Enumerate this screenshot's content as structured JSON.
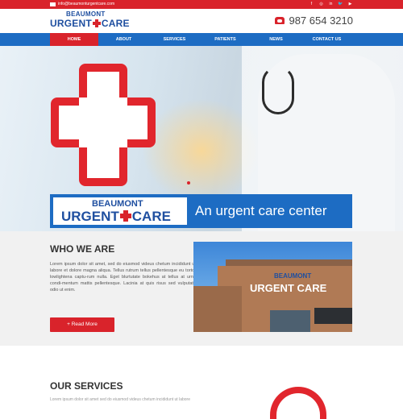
{
  "topbar": {
    "email": "info@beaumonturgentcare.com",
    "socials": [
      "f",
      "◎",
      "in",
      "🐦",
      "▶"
    ]
  },
  "header": {
    "logo_top": "BEAUMONT",
    "logo_urgent": "URGENT",
    "logo_care": "CARE",
    "phone": "987 654 3210"
  },
  "nav": {
    "items": [
      "HOME",
      "ABOUT",
      "SERVICES",
      "PATIENTS",
      "NEWS",
      "CONTACT US"
    ]
  },
  "banner": {
    "logo_top": "BEAUMONT",
    "logo_urgent": "URGENT",
    "logo_care": "CARE",
    "tagline": "An urgent care center"
  },
  "about": {
    "title": "WHO WE ARE",
    "body": "Lorem ipsum dolor sit amet, sed do eiusmod videus chetum incididunt ut labore et dolore magna aliqua. Tellus rutrum tellus pellentesque eu tortor lowlightena captu-rum nulla. Eget blurtutate bokehus at tellus at urna condi-mentum mattis pellentesque. Lacinia at quis risus sed vulputate odio ut enim.",
    "button": "+ Read More",
    "photo_sign_top": "BEAUMONT",
    "photo_sign_main": "URGENT CARE"
  },
  "services": {
    "title": "OUR SERVICES",
    "intro": "Lorem ipsum dolor sit amet sed do eiusmod videus chetum incididunt ut labore"
  },
  "colors": {
    "brand_red": "#d9232b",
    "brand_blue": "#1d6cc3"
  }
}
